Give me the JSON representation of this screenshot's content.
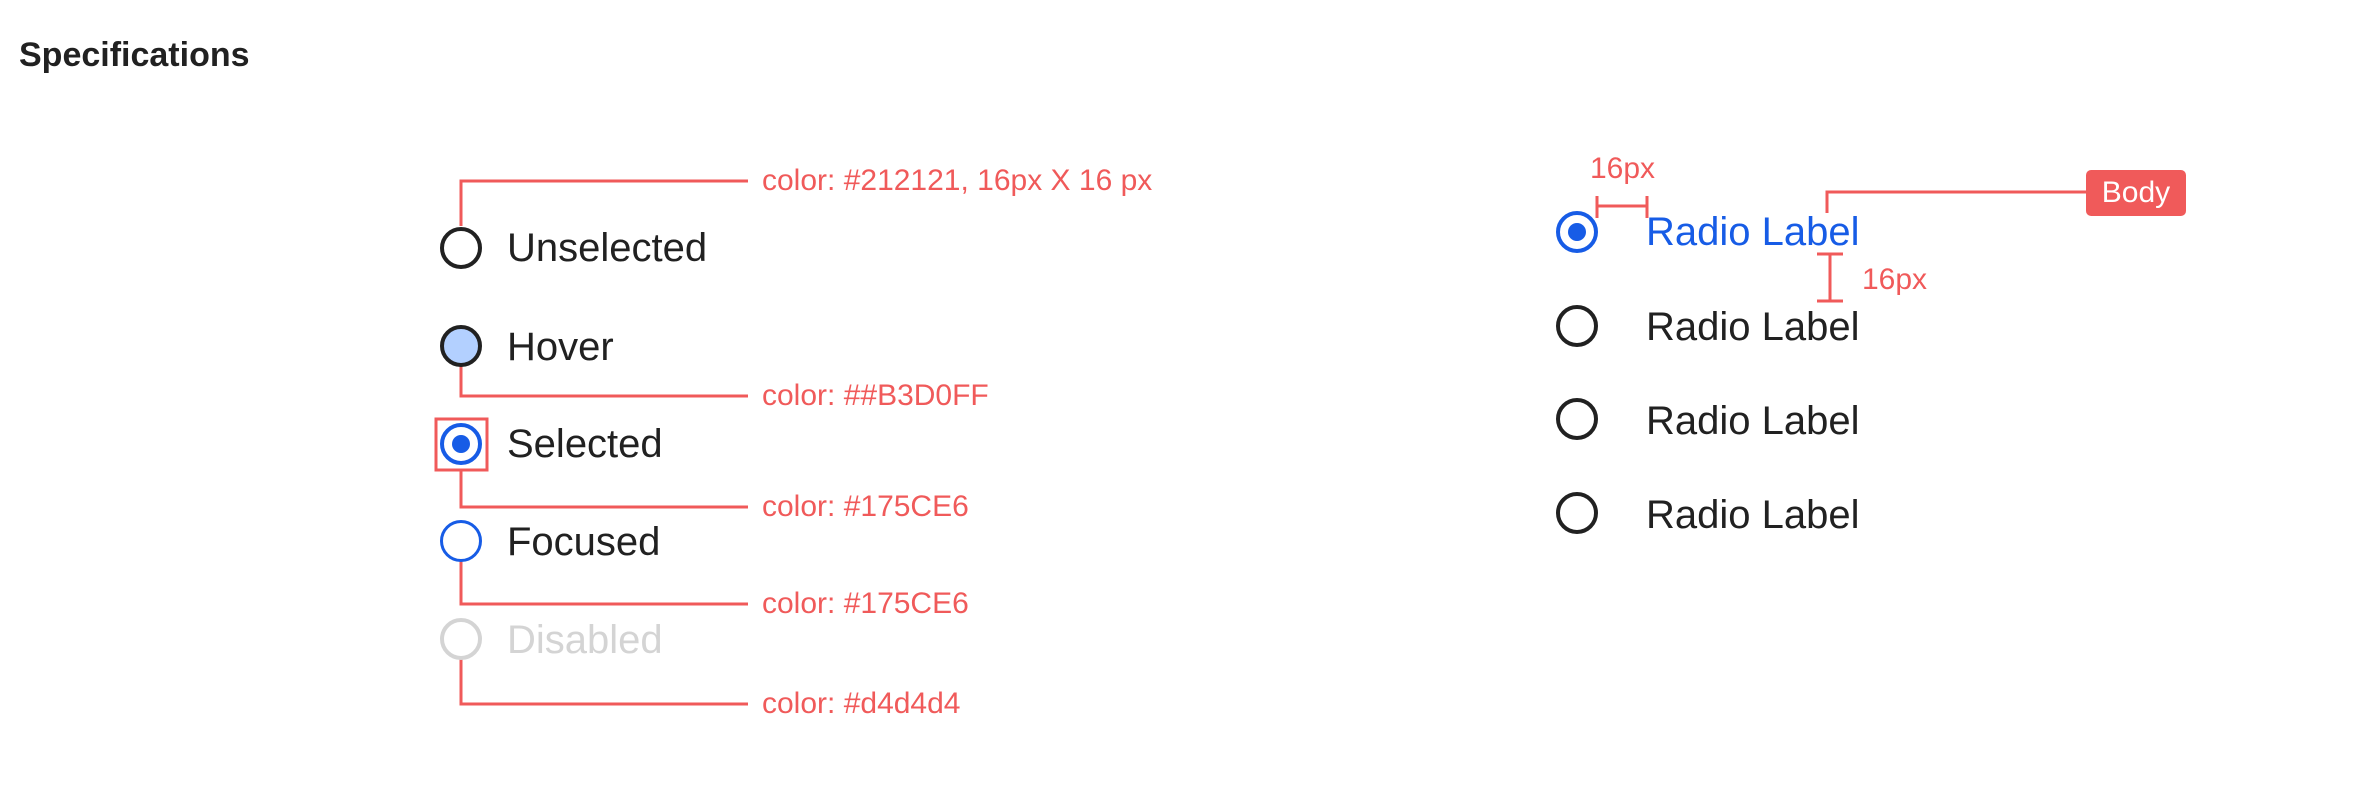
{
  "page": {
    "title": "Specifications"
  },
  "states": [
    {
      "label": "Unselected",
      "annotation": "color: #212121, 16px X 16 px"
    },
    {
      "label": "Hover",
      "annotation": "color: ##B3D0FF"
    },
    {
      "label": "Selected",
      "annotation": "color: #175CE6"
    },
    {
      "label": "Focused",
      "annotation": "color: #175CE6"
    },
    {
      "label": "Disabled",
      "annotation": "color: #d4d4d4"
    }
  ],
  "example": {
    "items": [
      {
        "label": "Radio Label",
        "state": "selected"
      },
      {
        "label": "Radio Label",
        "state": "unselected"
      },
      {
        "label": "Radio Label",
        "state": "unselected"
      },
      {
        "label": "Radio Label",
        "state": "unselected"
      }
    ],
    "horizontal_spacing": "16px",
    "vertical_spacing": "16px",
    "typography_tag": "Body"
  },
  "colors": {
    "text": "#212121",
    "hover_fill": "#B3D0FF",
    "selected": "#175CE6",
    "disabled": "#d4d4d4",
    "annotation": "#F05A5A"
  }
}
